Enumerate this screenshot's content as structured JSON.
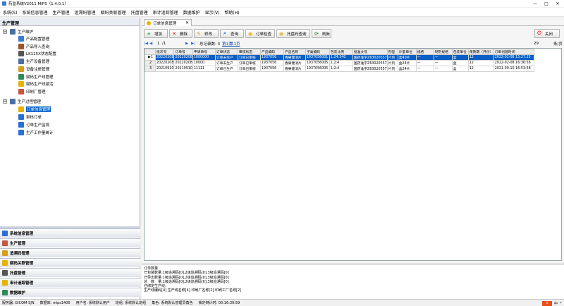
{
  "window": {
    "title": "药监系统V2011 MIPS（1.4.0.1）",
    "min": "—",
    "max": "□",
    "close": "✕"
  },
  "menu": [
    "系统(S)",
    "系统信息管理",
    "生产管理",
    "追溯码管理",
    "赋码关联管理",
    "托盘管理",
    "审计追踪管理",
    "数据维护",
    "显示(V)",
    "帮助(H)"
  ],
  "left": {
    "header": "生产管理",
    "groups": [
      {
        "label": "生产维护",
        "expander": "⊟"
      },
      {
        "label": "生产过程管理",
        "expander": "⊟"
      }
    ],
    "items1": [
      "产品配置管理",
      "产品导入查询",
      "LK115X状态配置",
      "生产设备管理",
      "设备注册管理",
      "赋码生产线管理",
      "赋码生产线激活",
      "印刷厂管理"
    ],
    "items2": [
      "订单信息管理",
      "审核订单",
      "订单生产监视",
      "生产工作量统计"
    ],
    "nav": [
      "系统信息管理",
      "生产管理",
      "追溯码管理",
      "赋码关联管理",
      "托盘管理",
      "审计追踪管理",
      "数据维护"
    ],
    "icon_colors": [
      "#3a7bd5",
      "#a0522d",
      "#555555",
      "#4a6fa5",
      "#d4a017",
      "#2e8b57",
      "#e6b400",
      "#c8553d"
    ]
  },
  "tab": {
    "label": "订单信息管理",
    "close": "✕"
  },
  "toolbar": {
    "buttons": [
      {
        "label": "增加",
        "icon": "+",
        "color": "#2ea043",
        "name": "add-button"
      },
      {
        "label": "删除",
        "icon": "✕",
        "color": "#d11",
        "name": "delete-button"
      },
      {
        "label": "修改",
        "icon": "✎",
        "color": "#d4a017",
        "name": "edit-button"
      },
      {
        "label": "查询",
        "icon": "⌕",
        "color": "#2a6fd6",
        "name": "query-button"
      },
      {
        "label": "订单检查",
        "icon": "◉",
        "color": "#e6b400",
        "name": "order-check-button"
      },
      {
        "label": "托盘码查询",
        "icon": "◉",
        "color": "#e6b400",
        "name": "pallet-query-button"
      },
      {
        "label": "刷新",
        "icon": "⟳",
        "color": "#2ea043",
        "name": "refresh-button"
      }
    ],
    "close_label": "关闭",
    "close_icon": "⏻"
  },
  "pager": {
    "first": "|◀",
    "prev": "◀",
    "page": "1",
    "of": "/1",
    "next": "▶",
    "last": "▶|",
    "total": "总记录数: 3",
    "cur": "第1页",
    "tot": "共1页",
    "per": "29",
    "unit": "条/页"
  },
  "grid": {
    "columns": [
      "",
      "批次号",
      "订单号",
      "申请单号",
      "订单状态",
      "审核状态",
      "产品编码",
      "产品名称",
      "子类编码",
      "包装比例",
      "批准文号",
      "剂型",
      "计量单位",
      "规格",
      "制剂规格",
      "包装单位",
      "保质期（月份）",
      "订单创建时间"
    ],
    "rows": [
      {
        "no": "1",
        "marker": "▶",
        "cells": [
          "20220208",
          "20220208",
          "1000000",
          "订单未生产",
          "订单已审核",
          "1937056",
          "香果健消片",
          "1937056001",
          "1:24:240",
          "国药准字Z63020557",
          "片剂",
          "盒40片",
          "—",
          "—",
          "盒",
          "12",
          "2022-02-08 15:27:25"
        ]
      },
      {
        "no": "2",
        "marker": "",
        "cells": [
          "20220208",
          "20220208",
          "10000",
          "订单未生产",
          "订单已审核",
          "1937056",
          "香果健消片",
          "1937056005",
          "1:2:4",
          "国药准字Z63020557",
          "片剂",
          "盒24片",
          "—",
          "—",
          "盒",
          "12",
          "2022-02-08 16:36:56"
        ]
      },
      {
        "no": "3",
        "marker": "",
        "cells": [
          "20210910",
          "20210910",
          "11111",
          "订单已生产",
          "订单已审核",
          "1937056",
          "香果健消片",
          "1937056005",
          "1:2:4",
          "国药准字Z63020557",
          "片剂",
          "盒24片",
          "—",
          "—",
          "盒",
          "12",
          "2021-09-10 16:53:58"
        ]
      }
    ]
  },
  "info": [
    "订单数量",
    "已包装数量:1级追溯码[0],2级追溯码[0],3级追溯码[0]",
    "已导出数量:1级追溯码[0],2级追溯码[0],3级追溯码[0]",
    "总　数　量:1级追溯码[0],2级追溯码[0],3级追溯码[0]",
    "已绑定生产线:",
    "生产线编码[4] 生产线名称[4] 印刷厂名称[2] 印刷工厂名称[2]"
  ],
  "status": [
    "服务器: GICOM-SJN",
    "数据库: mips1400",
    "用户名: 系统默认用户",
    "班组: 系统默认班组",
    "角色: 系统默认管理员角色",
    "锁定倒计时: 00:16:39:59"
  ],
  "tray": {
    "ime": "S",
    "lang": "中",
    "dot": "•"
  }
}
